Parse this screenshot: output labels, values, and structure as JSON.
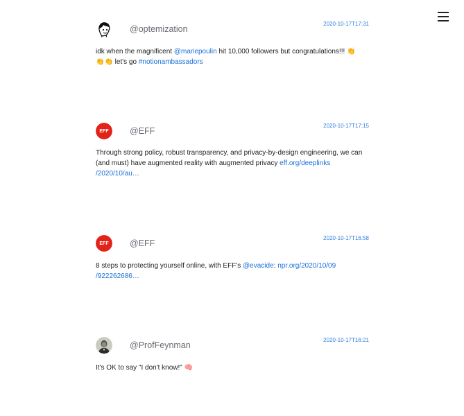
{
  "menu": {
    "icon": "hamburger-menu-icon"
  },
  "tweets": [
    {
      "handle": "@optemization",
      "timestamp": "2020-10-17T17:31",
      "avatar_icon": "cartoon-face-avatar",
      "body": {
        "t1": "idk when the magnificent ",
        "mention": "@mariepoulin",
        "t2": " hit 10,000 followers but congratulations!!! ",
        "clap1": "👏",
        "clap2": "👏",
        "clap3": "👏",
        "t3": " let's go ",
        "hashtag": "#notionambassadors"
      }
    },
    {
      "handle": "@EFF",
      "timestamp": "2020-10-17T17:15",
      "avatar_icon": "eff-logo",
      "avatar_text": "EFF",
      "body": {
        "t1": "Through strong policy, robust transparency, and privacy-by-design engineering, we can (and must) have augmented reality with augmented privacy ",
        "link1": "eff.org/deeplinks",
        "link2": "/2020/10/au…"
      }
    },
    {
      "handle": "@EFF",
      "timestamp": "2020-10-17T16:58",
      "avatar_icon": "eff-logo",
      "avatar_text": "EFF",
      "body": {
        "t1": "8 steps to protecting yourself online, with EFF's ",
        "mention": "@evacide",
        "t2": ": ",
        "link1": "npr.org/2020/10/09",
        "link2": "/922262686…"
      }
    },
    {
      "handle": "@ProfFeynman",
      "timestamp": "2020-10-17T16:21",
      "avatar_icon": "portrait-photo-avatar",
      "body": {
        "t1": "It's OK to say \"I don't know!\" ",
        "emoji": "🧠"
      }
    }
  ],
  "colors": {
    "link": "#1a6fd8",
    "timestamp": "#2f7de1",
    "eff_red": "#e2231a",
    "handle": "#666a70"
  }
}
